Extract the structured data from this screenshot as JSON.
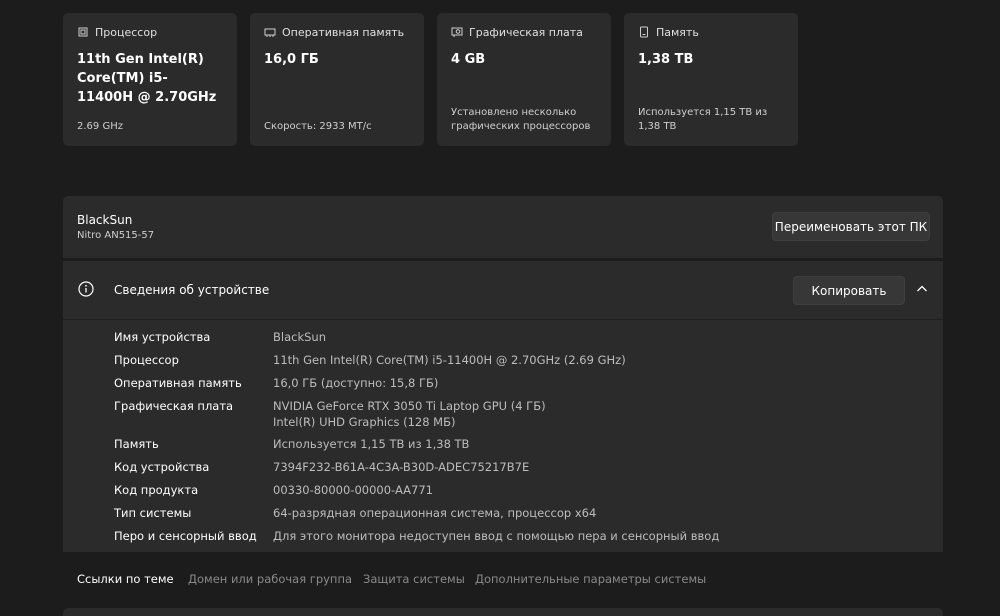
{
  "cards": [
    {
      "label": "Процессор",
      "value": "11th Gen Intel(R) Core(TM) i5-11400H @ 2.70GHz",
      "sub": "2.69 GHz",
      "icon": "cpu-icon"
    },
    {
      "label": "Оперативная память",
      "value": "16,0 ГБ",
      "sub": "Скорость: 2933 МТ/с",
      "icon": "ram-icon"
    },
    {
      "label": "Графическая плата",
      "value": "4 GB",
      "sub": "Установлено несколько графических процессоров",
      "icon": "gpu-icon"
    },
    {
      "label": "Память",
      "value": "1,38 ТВ",
      "sub": "Используется 1,15 ТВ из 1,38 ТВ",
      "icon": "storage-icon"
    }
  ],
  "pc": {
    "name": "BlackSun",
    "model": "Nitro AN515-57",
    "rename_label": "Переименовать этот ПК"
  },
  "device": {
    "title": "Сведения об устройстве",
    "copy_label": "Копировать",
    "specs": [
      {
        "label": "Имя устройства",
        "value": "BlackSun"
      },
      {
        "label": "Процессор",
        "value": "11th Gen Intel(R) Core(TM) i5-11400H @ 2.70GHz (2.69 GHz)"
      },
      {
        "label": "Оперативная память",
        "value": "16,0 ГБ (доступно: 15,8 ГБ)"
      },
      {
        "label": "Графическая плата",
        "value": "NVIDIA GeForce RTX 3050 Ti Laptop GPU (4 ГБ)",
        "value2": "Intel(R) UHD Graphics (128 МБ)"
      },
      {
        "label": "Память",
        "value": "Используется 1,15 ТВ из 1,38 ТВ"
      },
      {
        "label": "Код устройства",
        "value": "7394F232-B61A-4C3A-B30D-ADEC75217B7E"
      },
      {
        "label": "Код продукта",
        "value": "00330-80000-00000-AA771"
      },
      {
        "label": "Тип системы",
        "value": "64-разрядная операционная система, процессор x64"
      },
      {
        "label": "Перо и сенсорный ввод",
        "value": "Для этого монитора недоступен ввод с помощью пера и сенсорный ввод"
      }
    ]
  },
  "related": {
    "title": "Ссылки по теме",
    "links": [
      "Домен или рабочая группа",
      "Защита системы",
      "Дополнительные параметры системы"
    ]
  },
  "colors": {
    "background": "#1c1c1c",
    "card": "#2b2b2b",
    "button": "#373737",
    "text": "#ffffff",
    "muted_text": "#bdbdbd",
    "link_muted": "#8a8a8a"
  }
}
